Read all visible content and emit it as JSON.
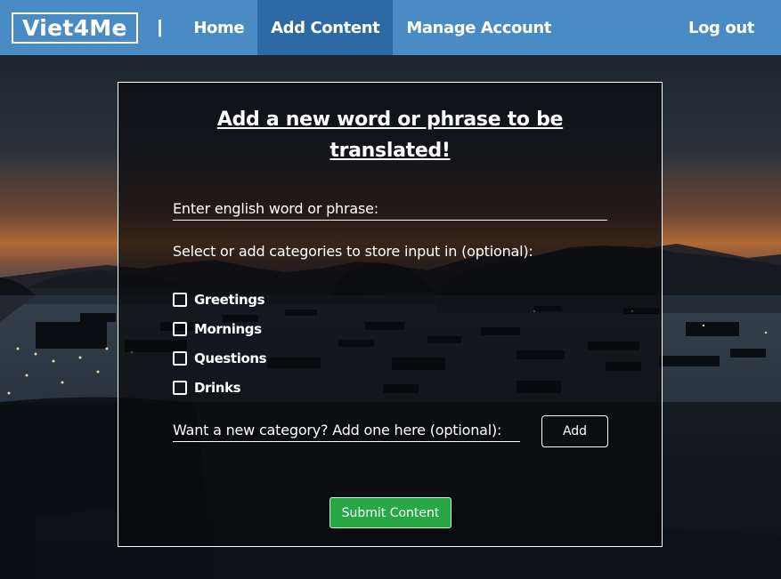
{
  "nav": {
    "brand": "Viet4Me",
    "separator": "|",
    "links": [
      {
        "label": "Home",
        "active": false
      },
      {
        "label": "Add Content",
        "active": true
      },
      {
        "label": "Manage Account",
        "active": false
      }
    ],
    "logout": "Log out"
  },
  "form": {
    "title": "Add a new word or phrase to be translated!",
    "word_placeholder": "Enter english word or phrase:",
    "categories_label": "Select or add categories to store input in (optional):",
    "categories": [
      {
        "label": "Greetings",
        "checked": false
      },
      {
        "label": "Mornings",
        "checked": false
      },
      {
        "label": "Questions",
        "checked": false
      },
      {
        "label": "Drinks",
        "checked": false
      }
    ],
    "new_category_placeholder": "Want a new category? Add one here (optional):",
    "add_label": "Add",
    "submit_label": "Submit Content"
  },
  "colors": {
    "nav_bg": "#4a8bc6",
    "nav_active": "#2d6aa5",
    "submit_bg": "#28a745"
  }
}
